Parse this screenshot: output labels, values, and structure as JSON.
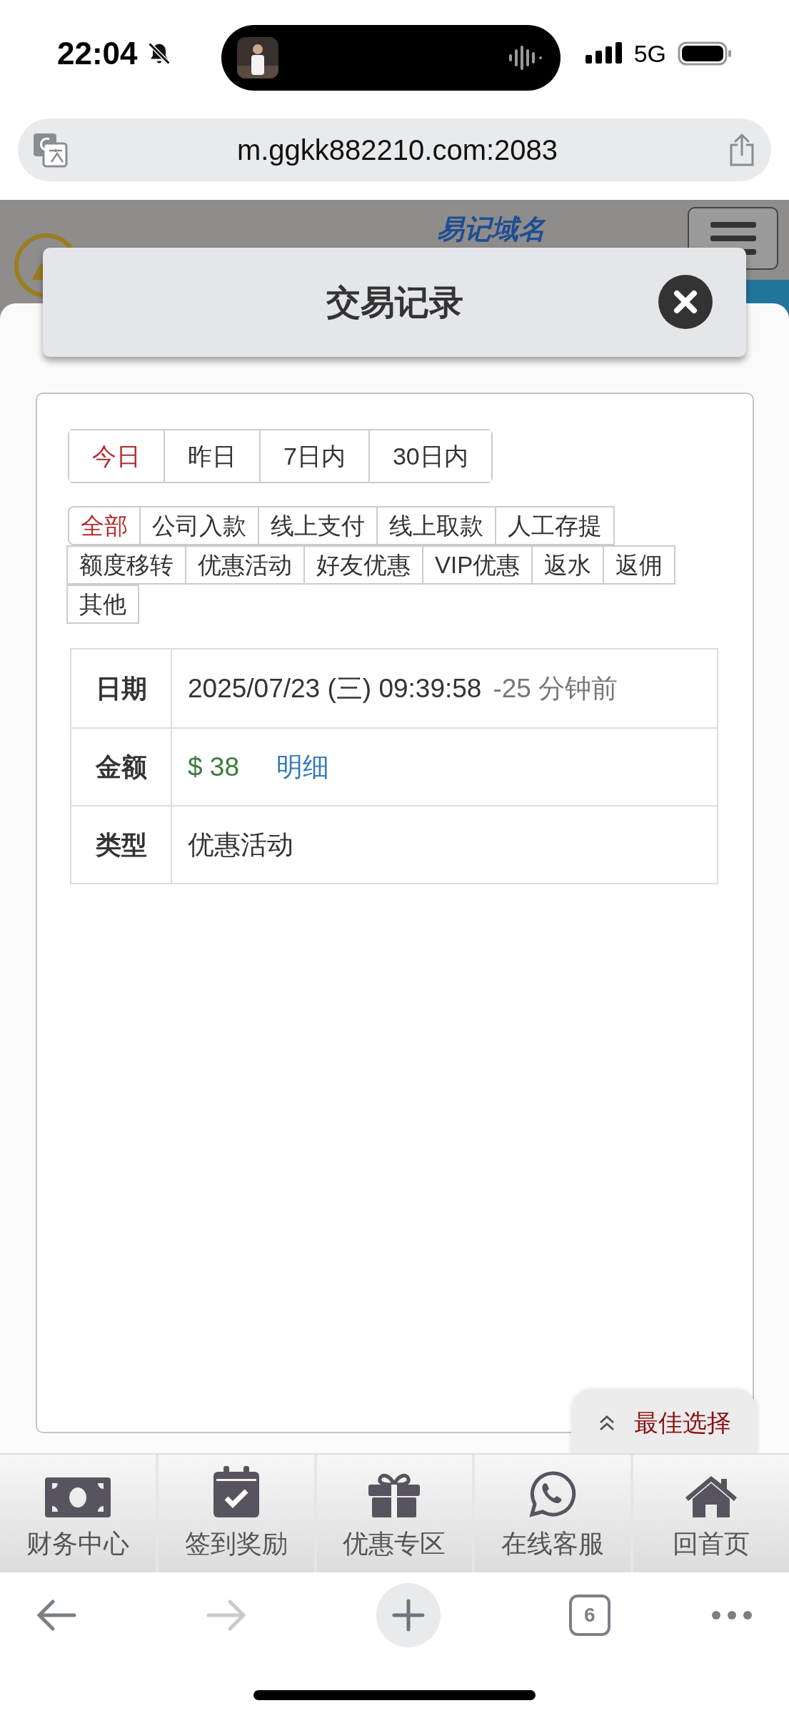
{
  "status_bar": {
    "time": "22:04",
    "network": "5G"
  },
  "browser": {
    "url": "m.ggkk882210.com:2083",
    "tab_count": "6"
  },
  "site_header": {
    "slogan": "易记域名"
  },
  "modal": {
    "title": "交易记录",
    "date_tabs": [
      {
        "label": "今日",
        "selected": true
      },
      {
        "label": "昨日",
        "selected": false
      },
      {
        "label": "7日内",
        "selected": false
      },
      {
        "label": "30日内",
        "selected": false
      }
    ],
    "type_filters": [
      {
        "label": "全部",
        "selected": true
      },
      {
        "label": "公司入款",
        "selected": false
      },
      {
        "label": "线上支付",
        "selected": false
      },
      {
        "label": "线上取款",
        "selected": false
      },
      {
        "label": "人工存提",
        "selected": false
      },
      {
        "label": "额度移转",
        "selected": false
      },
      {
        "label": "优惠活动",
        "selected": false
      },
      {
        "label": "好友优惠",
        "selected": false
      },
      {
        "label": "VIP优惠",
        "selected": false
      },
      {
        "label": "返水",
        "selected": false
      },
      {
        "label": "返佣",
        "selected": false
      },
      {
        "label": "其他",
        "selected": false
      }
    ],
    "record": [
      {
        "kind": "datetime",
        "label": "日期",
        "value": "2025/07/23 (三) 09:39:58",
        "note": "-25 分钟前"
      },
      {
        "kind": "amount",
        "label": "金额",
        "value": "$ 38",
        "link": "明细"
      },
      {
        "kind": "text",
        "label": "类型",
        "value": "优惠活动"
      }
    ]
  },
  "float_button": {
    "label": "最佳选择"
  },
  "bottom_nav": [
    {
      "kind": "money",
      "label": "财务中心"
    },
    {
      "kind": "calendar",
      "label": "签到奖励"
    },
    {
      "kind": "gift",
      "label": "优惠专区"
    },
    {
      "kind": "chat",
      "label": "在线客服"
    },
    {
      "kind": "home",
      "label": "回首页"
    }
  ]
}
